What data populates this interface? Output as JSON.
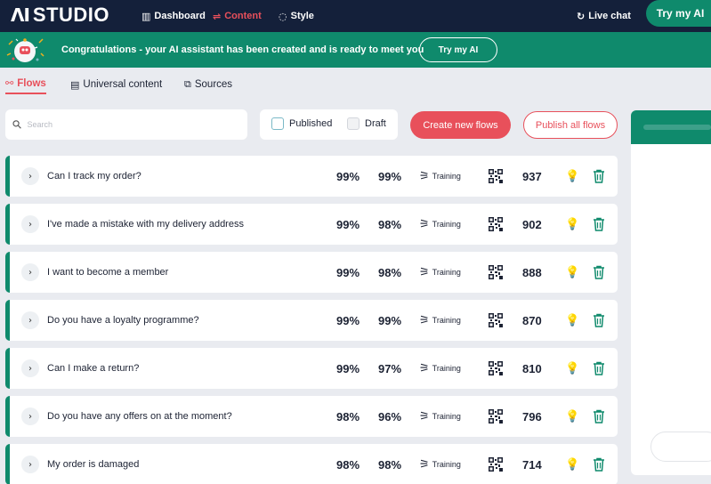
{
  "nav": {
    "logo_mark": "ΛI",
    "logo_text": "STUDIO",
    "items": [
      {
        "label": "Dashboard",
        "icon": "dashboard-icon"
      },
      {
        "label": "Content",
        "icon": "content-icon",
        "active": true
      },
      {
        "label": "Style",
        "icon": "palette-icon"
      }
    ],
    "live_chat": "Live chat",
    "try_ai": "Try my AI"
  },
  "banner": {
    "text": "Congratulations - your AI assistant has been created and is ready to meet you",
    "button": "Try my AI"
  },
  "tabs": [
    {
      "label": "Flows",
      "icon": "flows-icon",
      "active": true
    },
    {
      "label": "Universal content",
      "icon": "content-icon"
    },
    {
      "label": "Sources",
      "icon": "sources-icon"
    }
  ],
  "toolbar": {
    "search_placeholder": "Search",
    "published_label": "Published",
    "draft_label": "Draft",
    "create_label": "Create new flows",
    "publish_label": "Publish all flows"
  },
  "flows": [
    {
      "title": "Can I track my order?",
      "score1": "99%",
      "score2": "99%",
      "status": "Training",
      "count": "937"
    },
    {
      "title": "I've made a mistake with my delivery address",
      "score1": "99%",
      "score2": "98%",
      "status": "Training",
      "count": "902"
    },
    {
      "title": "I want to become a member",
      "score1": "99%",
      "score2": "98%",
      "status": "Training",
      "count": "888"
    },
    {
      "title": "Do you have a loyalty programme?",
      "score1": "99%",
      "score2": "99%",
      "status": "Training",
      "count": "870"
    },
    {
      "title": "Can I make a return?",
      "score1": "99%",
      "score2": "97%",
      "status": "Training",
      "count": "810"
    },
    {
      "title": "Do you have any offers on at the moment?",
      "score1": "98%",
      "score2": "96%",
      "status": "Training",
      "count": "796"
    },
    {
      "title": "My order is damaged",
      "score1": "98%",
      "score2": "98%",
      "status": "Training",
      "count": "714"
    }
  ],
  "colors": {
    "navy": "#14203a",
    "teal": "#0f8a6c",
    "coral": "#e8505b",
    "bulb": "#f2b01e"
  }
}
